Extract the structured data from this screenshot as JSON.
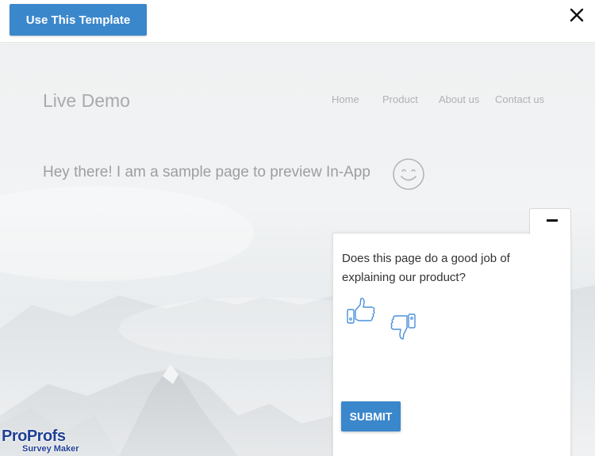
{
  "toolbar": {
    "use_template_label": "Use This Template",
    "close_icon": "close-icon"
  },
  "preview_site": {
    "logo": "Live Demo",
    "nav": [
      "Home",
      "Product",
      "About us",
      "Contact us"
    ],
    "hero_text": "Hey there! I am a sample page to preview In-App",
    "hero_icon": "smiley-icon"
  },
  "survey_widget": {
    "minimize_icon": "minimize-icon",
    "question": "Does this page do a good job of explaining our product?",
    "options": [
      {
        "icon": "thumbs-up-icon"
      },
      {
        "icon": "thumbs-down-icon"
      }
    ],
    "submit_label": "SUBMIT"
  },
  "branding": {
    "name": "ProProfs",
    "product": "Survey Maker"
  },
  "colors": {
    "primary_button": "#3b87cc",
    "brand_blue": "#1f3f93",
    "icon_blue": "#4a90d9"
  }
}
